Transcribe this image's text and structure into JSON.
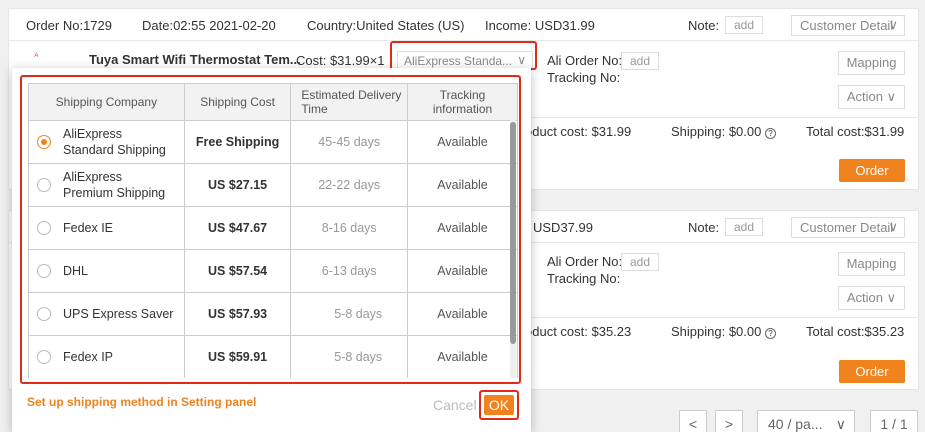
{
  "order1": {
    "order_no": "Order No:1729",
    "date": "Date:02:55 2021-02-20",
    "country": "Country:United States (US)",
    "income": "Income: USD31.99",
    "note_label": "Note:",
    "add_label": "add",
    "customer_detail": "Customer Detail",
    "product_title": "Tuya Smart Wifi Thermostat Tem...",
    "cost": "Cost: $31.99×1",
    "shipping_select": "AliExpress Standa...",
    "ali_order_no_label": "Ali Order No:",
    "tracking_no_label": "Tracking No:",
    "mapping_button": "Mapping",
    "action_button": "Action",
    "product_cost": "oduct cost: $31.99",
    "shipping": "Shipping: $0.00",
    "total_cost": "Total cost:$31.99",
    "order_button": "Order"
  },
  "order2": {
    "income": "USD37.99",
    "note_label": "Note:",
    "add_label": "add",
    "customer_detail": "Customer Detail",
    "ali_order_no_label": "Ali Order No:",
    "tracking_no_label": "Tracking No:",
    "mapping_button": "Mapping",
    "action_button": "Action",
    "product_cost": "oduct cost: $35.23",
    "shipping": "Shipping: $0.00",
    "total_cost": "Total cost:$35.23",
    "order_button": "Order"
  },
  "modal": {
    "columns": [
      "Shipping Company",
      "Shipping Cost",
      "Estimated Delivery Time",
      "Tracking information"
    ],
    "rows": [
      {
        "company": "AliExpress Standard Shipping",
        "cost": "Free Shipping",
        "days": "45-45 days",
        "tracking": "Available",
        "selected": true
      },
      {
        "company": "AliExpress Premium Shipping",
        "cost": "US $27.15",
        "days": "22-22 days",
        "tracking": "Available",
        "selected": false
      },
      {
        "company": "Fedex IE",
        "cost": "US $47.67",
        "days": "8-16 days",
        "tracking": "Available",
        "selected": false
      },
      {
        "company": "DHL",
        "cost": "US $57.54",
        "days": "6-13 days",
        "tracking": "Available",
        "selected": false
      },
      {
        "company": "UPS Express Saver",
        "cost": "US $57.93",
        "days": "5-8 days",
        "tracking": "Available",
        "selected": false
      },
      {
        "company": "Fedex IP",
        "cost": "US $59.91",
        "days": "5-8 days",
        "tracking": "Available",
        "selected": false
      }
    ],
    "setup_link": "Set up shipping method in Setting panel",
    "cancel_button": "Cancel",
    "ok_button": "OK"
  },
  "pagination": {
    "prev": "<",
    "next": ">",
    "page_size": "40 / pa...",
    "page_indicator": "1 / 1"
  },
  "colors": {
    "accent": "#f0831e",
    "highlight": "#e02b1b"
  },
  "icons": {
    "chevron": "chevron-down-icon",
    "help": "question-circle-icon"
  }
}
